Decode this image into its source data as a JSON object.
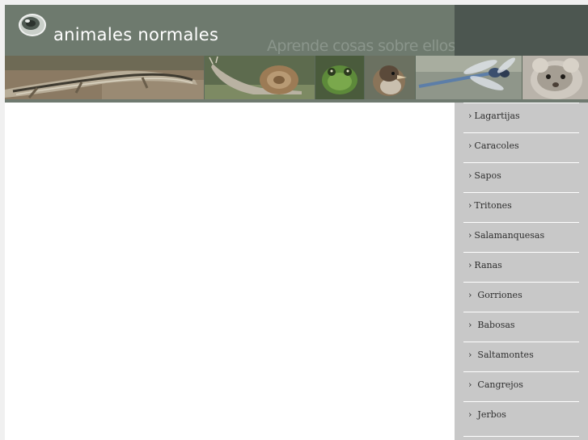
{
  "header": {
    "site_title": "animales normales",
    "tagline": "Aprende cosas sobre ellos",
    "logo_icon": "eye-logo-icon"
  },
  "banner": {
    "photos": [
      "lizard-photo",
      "snail-photo",
      "frog-photo",
      "sparrow-photo",
      "dragonfly-photo",
      "rodent-photo"
    ]
  },
  "sidebar": {
    "items": [
      {
        "arrow": "›",
        "label": "Lagartijas"
      },
      {
        "arrow": "›",
        "label": "Caracoles"
      },
      {
        "arrow": "›",
        "label": "Sapos"
      },
      {
        "arrow": "›",
        "label": "Tritones"
      },
      {
        "arrow": "›",
        "label": "Salamanquesas"
      },
      {
        "arrow": "›",
        "label": "Ranas"
      },
      {
        "arrow": "›",
        "label": "Gorriones"
      },
      {
        "arrow": "›",
        "label": "Babosas"
      },
      {
        "arrow": "›",
        "label": "Saltamontes"
      },
      {
        "arrow": "›",
        "label": "Cangrejos"
      },
      {
        "arrow": "›",
        "label": "Jerbos"
      }
    ]
  },
  "colors": {
    "header": "#6e7a6e",
    "header_dark": "#4c5650",
    "sidebar": "#c8c8c8"
  }
}
